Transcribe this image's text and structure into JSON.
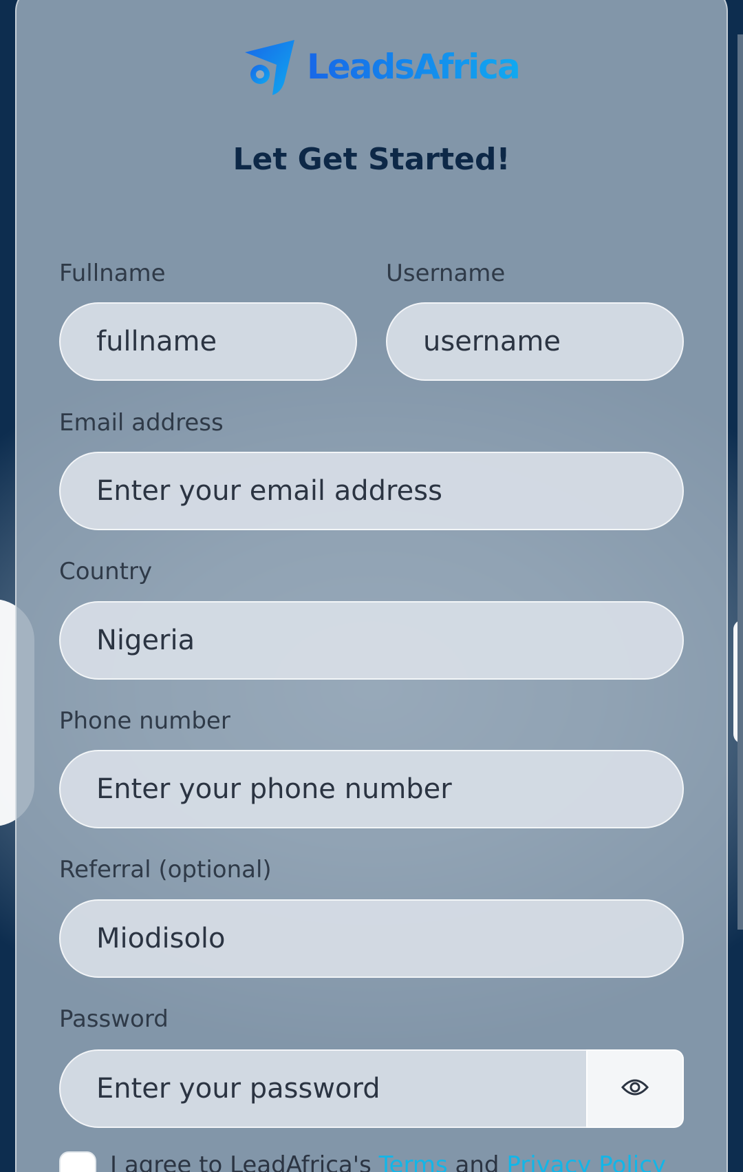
{
  "brand": {
    "name": "LeadsAfrica",
    "gradient_start": "#1767e8",
    "gradient_end": "#11a9f0"
  },
  "heading": "Let Get Started!",
  "form": {
    "fullname": {
      "label": "Fullname",
      "placeholder": "fullname"
    },
    "username": {
      "label": "Username",
      "placeholder": "username"
    },
    "email": {
      "label": "Email address",
      "placeholder": "Enter your email address"
    },
    "country": {
      "label": "Country",
      "value": "Nigeria"
    },
    "phone": {
      "label": "Phone number",
      "placeholder": "Enter your phone number"
    },
    "referral": {
      "label": "Referral (optional)",
      "value": "Miodisolo"
    },
    "password": {
      "label": "Password",
      "placeholder": "Enter your password",
      "toggle_icon": "eye-icon"
    }
  },
  "agreement": {
    "prefix": "I agree to LeadAfrica's",
    "terms": "Terms",
    "and": "and",
    "privacy": "Privacy Policy",
    "checked": false
  },
  "colors": {
    "page_background": "#0d2d4f",
    "heading": "#0d2847",
    "link": "#12b6e8"
  }
}
